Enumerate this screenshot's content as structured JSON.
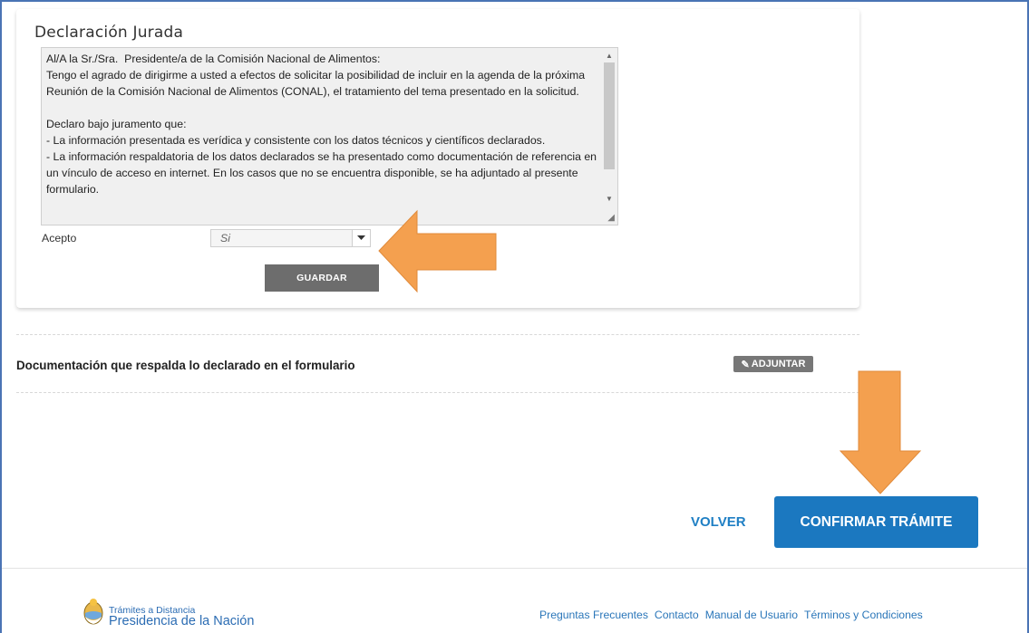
{
  "declaracion": {
    "title": "Declaración Jurada",
    "text": "Al/A la Sr./Sra.  Presidente/a de la Comisión Nacional de Alimentos:\nTengo el agrado de dirigirme a usted a efectos de solicitar la posibilidad de incluir en la agenda de la próxima Reunión de la Comisión Nacional de Alimentos (CONAL), el tratamiento del tema presentado en la solicitud.\n\nDeclaro bajo juramento que:\n- La información presentada es verídica y consistente con los datos técnicos y científicos declarados.\n- La información respaldatoria de los datos declarados se ha presentado como documentación de referencia en un vínculo de acceso en internet. En los casos que no se encuentra disponible, se ha adjuntado al presente formulario.",
    "acepto_label": "Acepto",
    "acepto_value": "Si",
    "guardar_label": "GUARDAR"
  },
  "documentacion": {
    "title": "Documentación que respalda lo declarado en el formulario",
    "adjuntar_label": "ADJUNTAR",
    "adjuntar_icon": "paperclip-icon"
  },
  "actions": {
    "volver_label": "VOLVER",
    "confirmar_label": "CONFIRMAR TRÁMITE"
  },
  "footer": {
    "logo_small": "Trámites a Distancia",
    "logo_big": "Presidencia de la Nación",
    "links": [
      "Preguntas Frecuentes",
      "Contacto",
      "Manual de Usuario",
      "Términos y Condiciones"
    ]
  },
  "colors": {
    "primary": "#1b78c0",
    "arrow": "#f4a04f",
    "frame": "#4a74b4"
  }
}
